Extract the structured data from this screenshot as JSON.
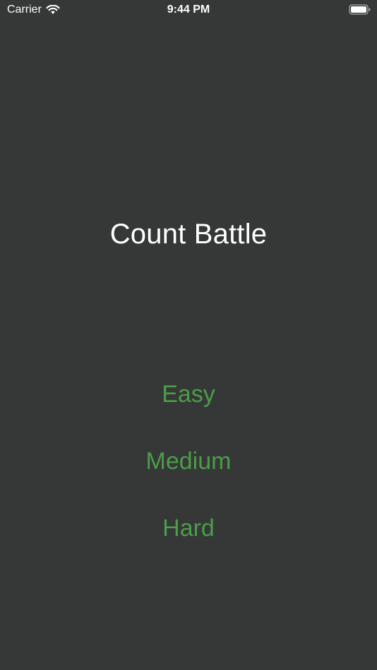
{
  "status_bar": {
    "carrier": "Carrier",
    "time": "9:44 PM"
  },
  "app": {
    "title": "Count Battle"
  },
  "difficulty": {
    "easy": "Easy",
    "medium": "Medium",
    "hard": "Hard"
  },
  "colors": {
    "background": "#363737",
    "accent": "#4b9d48",
    "text": "#ffffff"
  },
  "icons": {
    "wifi": "wifi-icon",
    "battery": "battery-icon"
  }
}
